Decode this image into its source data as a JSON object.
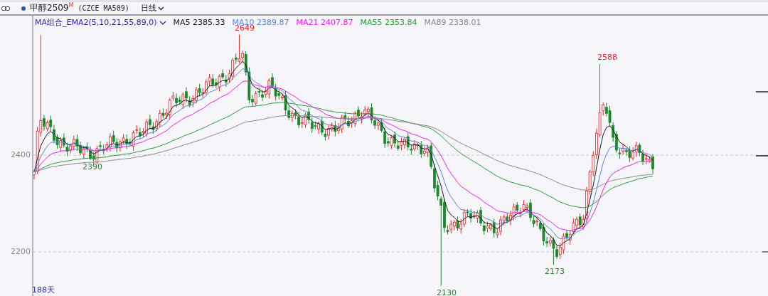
{
  "toolbar": {
    "title": "甲醇2509",
    "title_mark": "M",
    "contract": "(CZCE MA509)",
    "period": "日线"
  },
  "legend": {
    "indicator": "MA组合_EMA2(5,10,21,55,89,0)",
    "items": [
      {
        "label": "MA5 2385.33",
        "color": "#1a1a1a"
      },
      {
        "label": "MA10 2389.87",
        "color": "#5a82e6"
      },
      {
        "label": "MA21 2407.87",
        "color": "#f020f0"
      },
      {
        "label": "MA55 2353.84",
        "color": "#2e9a3a"
      },
      {
        "label": "MA89 2338.01",
        "color": "#8a8a8a"
      }
    ]
  },
  "chart": {
    "y_labels": [
      "2400",
      "2200"
    ],
    "price_labels": [
      {
        "text": "2649",
        "kind": "high"
      },
      {
        "text": "2390",
        "kind": "low"
      },
      {
        "text": "2130",
        "kind": "low"
      },
      {
        "text": "2173",
        "kind": "low"
      },
      {
        "text": "2588",
        "kind": "high"
      }
    ],
    "span": "188天"
  }
}
